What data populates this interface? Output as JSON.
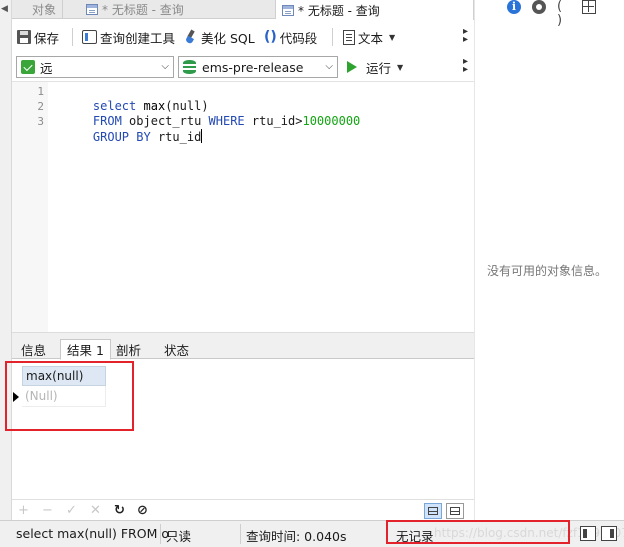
{
  "tabs": [
    {
      "label": "对象",
      "active": false
    },
    {
      "label": "* 无标题 - 查询",
      "active": false
    },
    {
      "label": "* 无标题 - 查询",
      "active": true
    }
  ],
  "toolbar": {
    "save_label": "保存",
    "query_builder_label": "查询创建工具",
    "beautify_label": "美化 SQL",
    "snippet_label": "代码段",
    "text_label": "文本"
  },
  "connection": {
    "value": "远"
  },
  "database": {
    "value": "ems-pre-release"
  },
  "run": {
    "label": "运行"
  },
  "editor": {
    "line_numbers": [
      "1",
      "2",
      "3"
    ],
    "lines": [
      [
        "select max(null)"
      ],
      [
        "FROM object_rtu WHERE rtu_id>10000000"
      ],
      [
        "GROUP BY rtu_id"
      ]
    ]
  },
  "result_tabs": [
    "信息",
    "结果 1",
    "剖析",
    "状态"
  ],
  "active_result_tab": 1,
  "grid": {
    "columns": [
      "max(null)"
    ],
    "rows": [
      [
        "(Null)"
      ]
    ]
  },
  "right_panel": {
    "icons": [
      "info-icon",
      "eye-icon",
      "parentheses-icon",
      "grid-icon"
    ],
    "empty_message": "没有可用的对象信息。"
  },
  "status": {
    "sql": "select max(null) FROM o",
    "readonly": "只读",
    "query_time": "查询时间: 0.040s",
    "records": "无记录",
    "watermark": "https://blog.csdn.net/fzf1996_0725"
  },
  "colors": {
    "keyword": "#2349b3",
    "number": "#14a514",
    "highlight_box": "#e3232c"
  }
}
